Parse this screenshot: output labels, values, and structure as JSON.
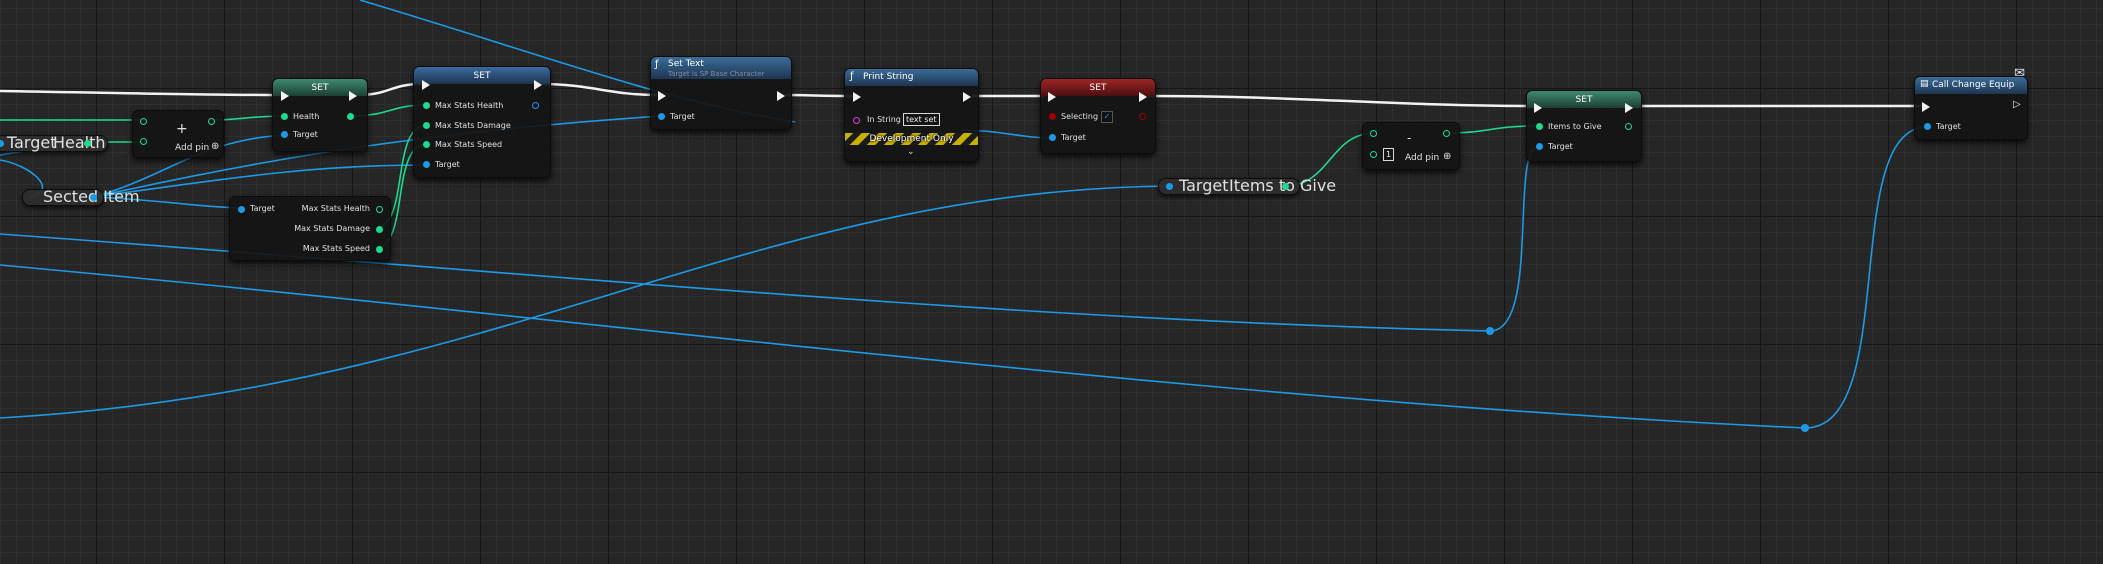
{
  "colors": {
    "background": "#262626",
    "exec": "#f2f2f2",
    "object_pin": "#1d9ae6",
    "float_pin": "#1ed98f",
    "bool_pin": "#a00000",
    "string_pin": "#e040e0",
    "set_header": "#2b6b56",
    "function_header": "#2d5c86",
    "selecting_set_header": "#8a1818"
  },
  "nodes": {
    "set_health": {
      "title": "SET",
      "pins": {
        "health": "Health",
        "target": "Target"
      }
    },
    "add_float": {
      "symbol": "+",
      "add_pin": "Add pin"
    },
    "get_target_health": {
      "target": "Target",
      "health": "Health"
    },
    "sected_item": {
      "label": "Sected Item"
    },
    "break_stats": {
      "target": "Target",
      "max_health": "Max Stats Health",
      "max_damage": "Max Stats Damage",
      "max_speed": "Max Stats Speed"
    },
    "set_stats": {
      "title": "SET",
      "pins": {
        "max_health": "Max Stats Health",
        "max_damage": "Max Stats Damage",
        "max_speed": "Max Stats Speed",
        "target": "Target"
      }
    },
    "set_text": {
      "title": "Set Text",
      "subtitle": "Target is SP Base Character",
      "target": "Target"
    },
    "print_string": {
      "title": "Print String",
      "in_string_label": "In String",
      "in_string_value": "text set",
      "dev_only": "Development Only"
    },
    "set_selecting": {
      "title": "SET",
      "selecting": "Selecting",
      "target": "Target"
    },
    "get_items_to_give": {
      "target": "Target",
      "items": "Items to Give"
    },
    "subtract_int": {
      "symbol": "-",
      "value": "1",
      "add_pin": "Add pin"
    },
    "set_items_to_give": {
      "title": "SET",
      "items": "Items to Give",
      "target": "Target"
    },
    "call_change_equip": {
      "title": "Call Change Equip",
      "target": "Target"
    }
  }
}
